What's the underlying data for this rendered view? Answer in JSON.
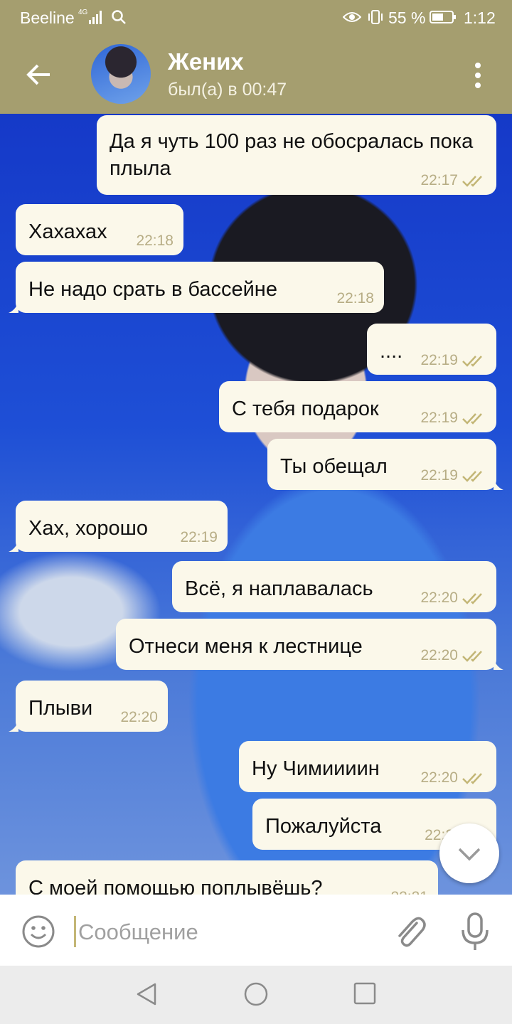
{
  "status_bar": {
    "carrier": "Beeline",
    "network": "4G",
    "battery_percent": "55 %",
    "time": "1:12"
  },
  "header": {
    "contact_name": "Жених",
    "last_seen": "был(а) в 00:47",
    "back_icon": "arrow-back-icon",
    "menu_icon": "more-vert-icon"
  },
  "messages": [
    {
      "direction": "outgoing",
      "text": "Да я чуть 100 раз не обосралась пока плыла",
      "time": "22:17",
      "read": true
    },
    {
      "direction": "incoming",
      "text": "Хахахах",
      "time": "22:18"
    },
    {
      "direction": "incoming",
      "text": "Не надо срать в бассейне",
      "time": "22:18"
    },
    {
      "direction": "outgoing",
      "text": "....",
      "time": "22:19",
      "read": true
    },
    {
      "direction": "outgoing",
      "text": "С тебя подарок",
      "time": "22:19",
      "read": true
    },
    {
      "direction": "outgoing",
      "text": "Ты обещал",
      "time": "22:19",
      "read": true
    },
    {
      "direction": "incoming",
      "text": "Хах, хорошо",
      "time": "22:19"
    },
    {
      "direction": "outgoing",
      "text": "Всё, я наплавалась",
      "time": "22:20",
      "read": true
    },
    {
      "direction": "outgoing",
      "text": "Отнеси меня к лестнице",
      "time": "22:20",
      "read": true
    },
    {
      "direction": "incoming",
      "text": "Плыви",
      "time": "22:20"
    },
    {
      "direction": "outgoing",
      "text": "Ну Чимиииин",
      "time": "22:20",
      "read": true
    },
    {
      "direction": "outgoing",
      "text": "Пожалуйста",
      "time": "22:2",
      "read": true
    },
    {
      "direction": "incoming",
      "text": "С моей помощью поплывёшь?",
      "time": "22:21"
    }
  ],
  "input": {
    "placeholder": "Сообщение"
  },
  "colors": {
    "header": "#a59e6f",
    "bubble": "#fbf8ea",
    "read_ticks": "#c3b676"
  }
}
